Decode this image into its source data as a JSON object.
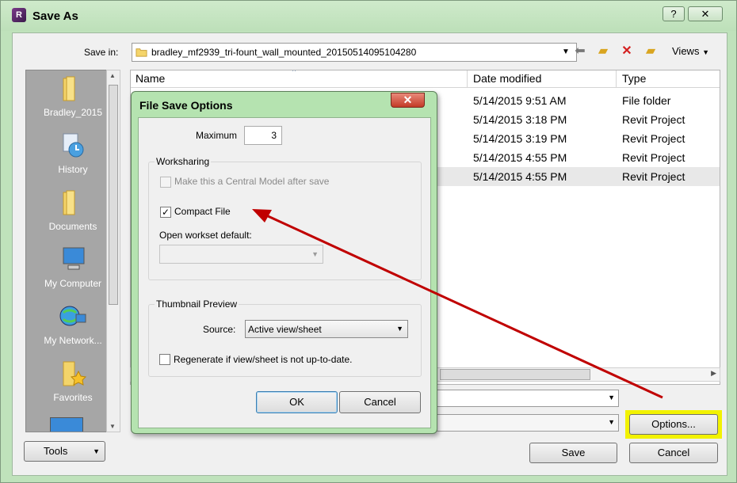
{
  "window": {
    "title": "Save As",
    "help_label": "?",
    "close_label": "✕"
  },
  "savein": {
    "label": "Save in:",
    "value": "bradley_mf2939_tri-fount_wall_mounted_20150514095104280",
    "views_label": "Views"
  },
  "places": [
    {
      "label": "Bradley_2015",
      "icon": "folder-icon"
    },
    {
      "label": "History",
      "icon": "history-icon"
    },
    {
      "label": "Documents",
      "icon": "folder-icon"
    },
    {
      "label": "My Computer",
      "icon": "computer-icon"
    },
    {
      "label": "My Network...",
      "icon": "network-icon"
    },
    {
      "label": "Favorites",
      "icon": "favorites-icon"
    }
  ],
  "filelist": {
    "columns": [
      "Name",
      "Date modified",
      "Type"
    ],
    "rows": [
      {
        "date": "5/14/2015 9:51 AM",
        "type": "File folder"
      },
      {
        "date": "5/14/2015 3:18 PM",
        "type": "Revit Project"
      },
      {
        "date": "5/14/2015 3:19 PM",
        "type": "Revit Project"
      },
      {
        "date": "5/14/2015 4:55 PM",
        "type": "Revit Project"
      },
      {
        "date": "5/14/2015 4:55 PM",
        "type": "Revit Project"
      }
    ]
  },
  "buttons": {
    "options": "Options...",
    "save": "Save",
    "cancel": "Cancel",
    "tools": "Tools"
  },
  "dialog": {
    "title": "File Save Options",
    "close_label": "✕",
    "maximum_label": "Maximum",
    "maximum_value": "3",
    "worksharing_title": "Worksharing",
    "central_model_label": "Make this a Central Model after save",
    "compact_file_label": "Compact File",
    "open_workset_label": "Open workset default:",
    "open_workset_value": "",
    "thumbnail_title": "Thumbnail Preview",
    "source_label": "Source:",
    "source_value": "Active view/sheet",
    "regenerate_label": "Regenerate if view/sheet is not up-to-date.",
    "ok_label": "OK",
    "cancel_label": "Cancel"
  },
  "colors": {
    "highlight": "#f2f200",
    "arrow": "#c00000",
    "dialog_frame": "#b5e3b0"
  }
}
